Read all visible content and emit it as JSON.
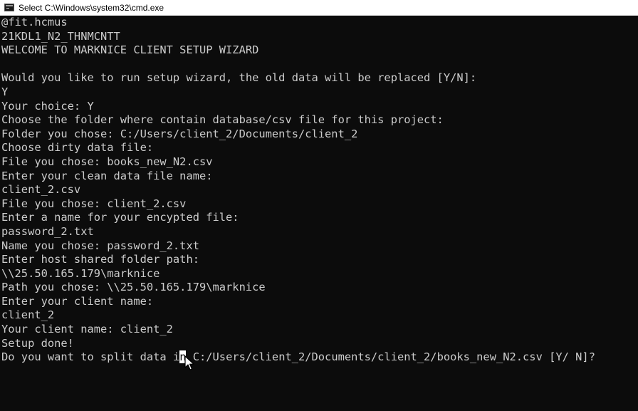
{
  "window": {
    "title": "Select C:\\Windows\\system32\\cmd.exe",
    "icon": "cmd-app-icon"
  },
  "console": {
    "lines": [
      "@fit.hcmus",
      "21KDL1_N2_THNMCNTT",
      "WELCOME TO MARKNICE CLIENT SETUP WIZARD",
      "",
      "Would you like to run setup wizard, the old data will be replaced [Y/N]:",
      "Y",
      "Your choice: Y",
      "Choose the folder where contain database/csv file for this project:",
      "Folder you chose: C:/Users/client_2/Documents/client_2",
      "Choose dirty data file:",
      "File you chose: books_new_N2.csv",
      "Enter your clean data file name:",
      "client_2.csv",
      "File you chose: client_2.csv",
      "Enter a name for your encypted file:",
      "password_2.txt",
      "Name you chose: password_2.txt",
      "Enter host shared folder path:",
      "\\\\25.50.165.179\\marknice",
      "Path you chose: \\\\25.50.165.179\\marknice",
      "Enter your client name:",
      "client_2",
      "Your client name: client_2",
      "Setup done!"
    ],
    "prompt": {
      "before": "Do you want to split data i",
      "selected": "n",
      "after": " C:/Users/client_2/Documents/client_2/books_new_N2.csv [Y/ N]?"
    }
  },
  "colors": {
    "background": "#0c0c0c",
    "text": "#cccccc",
    "titlebar": "#ffffff",
    "selection": "#ffffff"
  }
}
